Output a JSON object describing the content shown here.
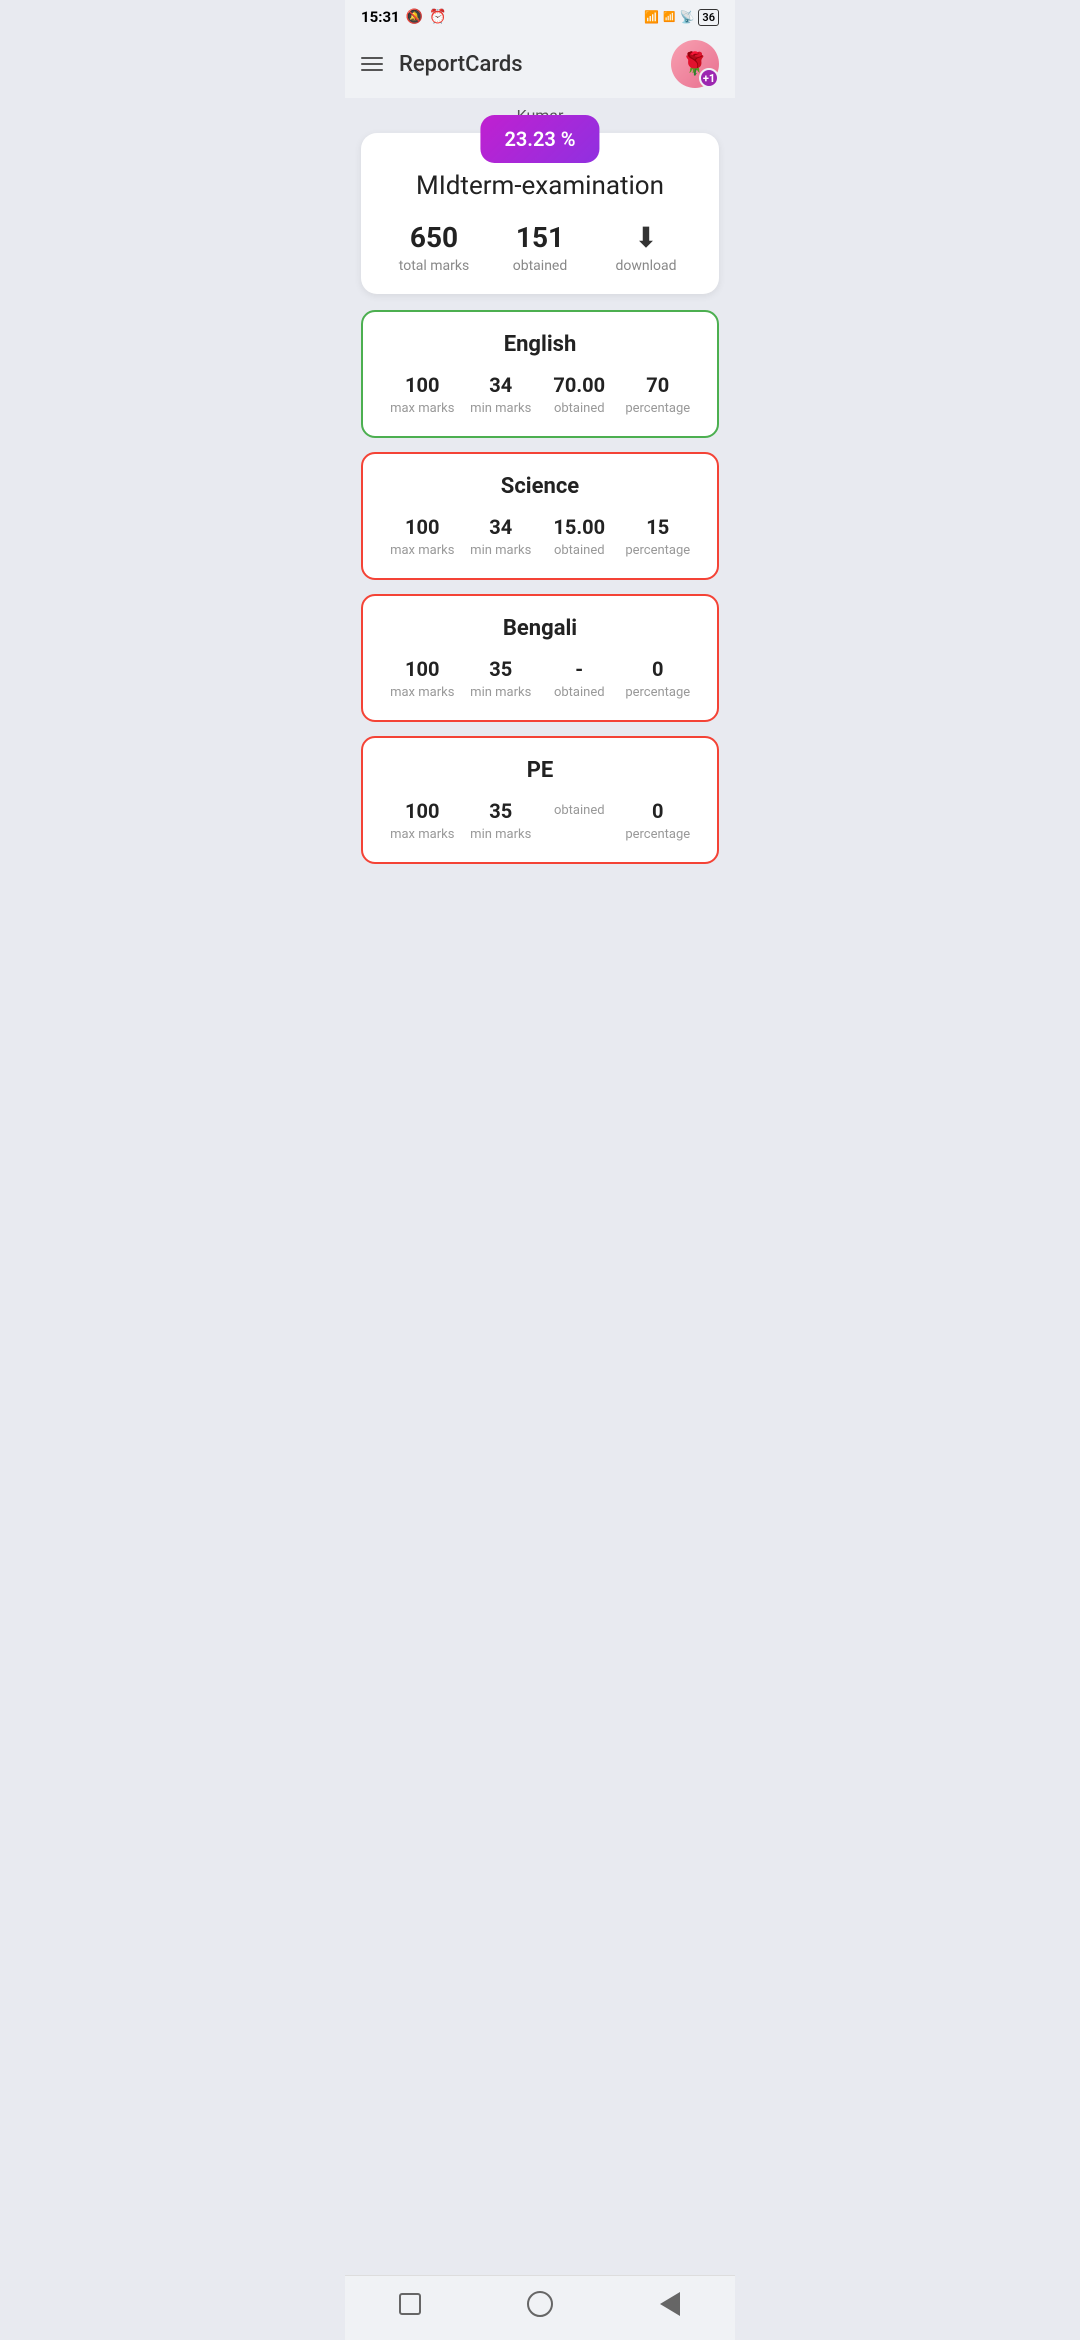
{
  "statusBar": {
    "time": "15:31",
    "battery": "36"
  },
  "navbar": {
    "title": "ReportCards",
    "avatarBadge": "+1"
  },
  "student": {
    "name": "Kumar"
  },
  "summary": {
    "percentage": "23.23 %",
    "examTitle": "MIdterm-examination",
    "totalMarks": "650",
    "totalMarksLabel": "total marks",
    "obtainedMarks": "151",
    "obtainedLabel": "obtained",
    "downloadLabel": "download"
  },
  "subjects": [
    {
      "name": "English",
      "status": "pass",
      "maxMarks": "100",
      "minMarks": "34",
      "obtained": "70.00",
      "percentage": "70"
    },
    {
      "name": "Science",
      "status": "fail",
      "maxMarks": "100",
      "minMarks": "34",
      "obtained": "15.00",
      "percentage": "15"
    },
    {
      "name": "Bengali",
      "status": "fail",
      "maxMarks": "100",
      "minMarks": "35",
      "obtained": "-",
      "percentage": "0"
    },
    {
      "name": "PE",
      "status": "fail",
      "maxMarks": "100",
      "minMarks": "35",
      "obtained": "",
      "percentage": "0"
    }
  ],
  "labels": {
    "maxMarks": "max marks",
    "minMarks": "min marks",
    "obtained": "obtained",
    "percentage": "percentage"
  }
}
